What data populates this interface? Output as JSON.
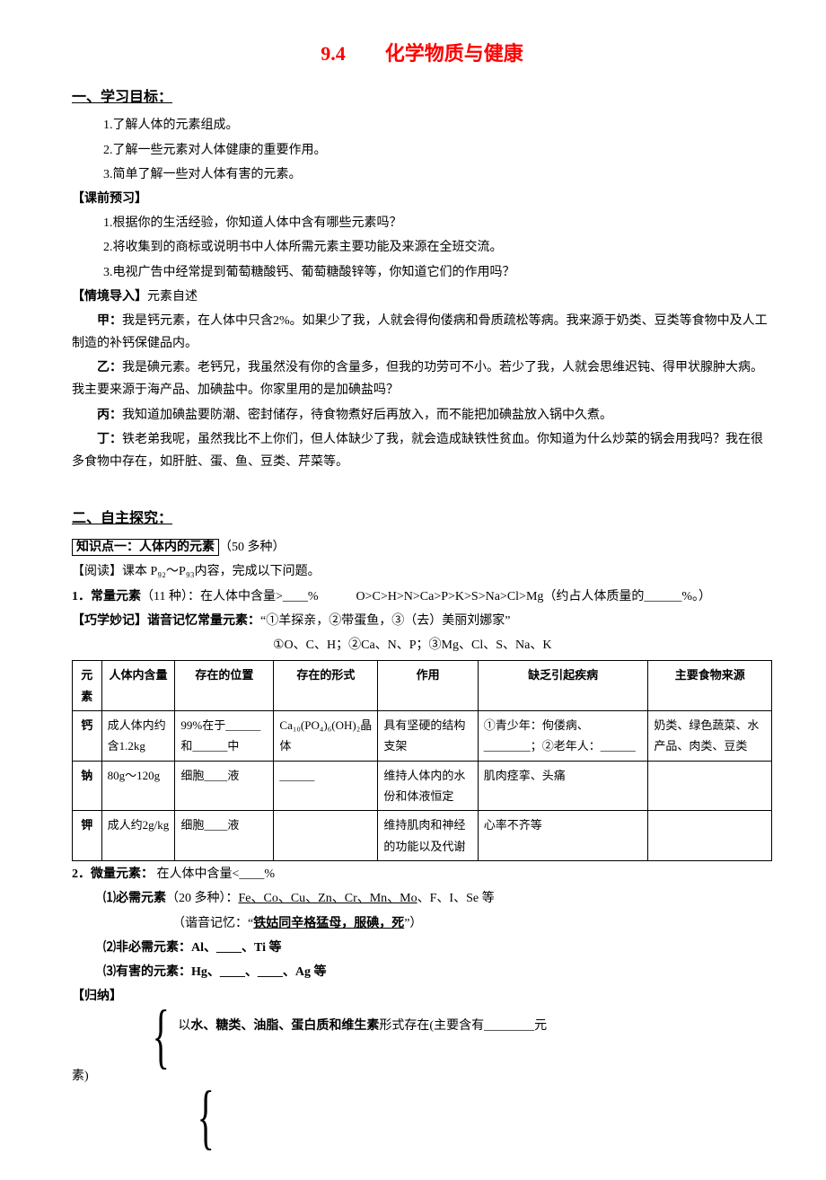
{
  "title": "9.4　　化学物质与健康",
  "section1": {
    "header": "一、学习目标：",
    "items": [
      "1.了解人体的元素组成。",
      "2.了解一些元素对人体健康的重要作用。",
      "3.简单了解一些对人体有害的元素。"
    ]
  },
  "preview": {
    "header": "【课前预习】",
    "items": [
      "1.根据你的生活经验，你知道人体中含有哪些元素吗？",
      "2.将收集到的商标或说明书中人体所需元素主要功能及来源在全班交流。",
      "3.电视广告中经常提到葡萄糖酸钙、葡萄糖酸锌等，你知道它们的作用吗？"
    ]
  },
  "intro": {
    "header": "【情境导入】",
    "subtitle": "元素自述",
    "jia_label": "甲：",
    "jia": "我是钙元素，在人体中只含2%。如果少了我，人就会得佝偻病和骨质疏松等病。我来源于奶类、豆类等食物中及人工制造的补钙保健品内。",
    "yi_label": "乙：",
    "yi": "我是碘元素。老钙兄，我虽然没有你的含量多，但我的功劳可不小。若少了我，人就会思维迟钝、得甲状腺肿大病。我主要来源于海产品、加碘盐中。你家里用的是加碘盐吗？",
    "bing_label": "丙：",
    "bing": "我知道加碘盐要防潮、密封储存，待食物煮好后再放入，而不能把加碘盐放入锅中久煮。",
    "ding_label": "丁：",
    "ding": "铁老弟我呢，虽然我比不上你们，但人体缺少了我，就会造成缺铁性贫血。你知道为什么炒菜的锅会用我吗？我在很多食物中存在，如肝脏、蛋、鱼、豆类、芹菜等。"
  },
  "section2": {
    "header": "二、自主探究：",
    "knowledge1": {
      "title": "知识点一：人体内的元素",
      "note": "（50 多种）"
    },
    "read": "【阅读】课本 P₉₂～P₉₃内容，完成以下问题。",
    "changLiang": {
      "label": "1．常量元素",
      "paren": "（11 种）：在人体中含量>____%　　　O>C>H>N>Ca>P>K>S>Na>Cl>Mg（约占人体质量的______%。）"
    },
    "mnemonic": {
      "head": "【巧学妙记】谐音记忆常量元素：",
      "quote": "“①羊探亲，②带蛋鱼，③（去）美丽刘娜家”",
      "line2": "①O、C、H；②Ca、N、P；③Mg、Cl、S、Na、K"
    },
    "table": {
      "headers": [
        "元素",
        "人体内含量",
        "存在的位置",
        "存在的形式",
        "作用",
        "缺乏引起疾病",
        "主要食物来源"
      ],
      "rows": [
        {
          "el": "钙",
          "amount": "成人体内约含1.2kg",
          "loc": "99%在于______和______中",
          "form": "Ca₁₀(PO₄)₆(OH)₂晶体",
          "role": "具有坚硬的结构支架",
          "deficiency": "①青少年：佝偻病、________；②老年人：______",
          "source": "奶类、绿色蔬菜、水产品、肉类、豆类"
        },
        {
          "el": "钠",
          "amount": "80g～120g",
          "loc": "细胞____液",
          "form": "______",
          "role": "维持人体内的水份和体液恒定",
          "deficiency": "肌肉痉挛、头痛",
          "source": ""
        },
        {
          "el": "钾",
          "amount": "成人约2g/kg",
          "loc": "细胞____液",
          "form": "",
          "role": "维持肌肉和神经的功能以及代谢",
          "deficiency": "心率不齐等",
          "source": ""
        }
      ]
    },
    "weiliang": {
      "label": "2．微量元素：",
      "text": " 在人体中含量<____%",
      "item1_label": "⑴必需元素",
      "item1_text": "（20 多种）：",
      "item1_list": "Fe、Co、Cu、Zn、Cr、Mn、Mo",
      "item1_rest": "、F、I、Se 等",
      "item1_mnemonic": "（谐音记忆：“",
      "item1_mnemonic_u": "铁姑同辛格猛母，服碘，死",
      "item1_mnemonic_end": "”）",
      "item2": "⑵非必需元素：Al、____、Ti 等",
      "item3": "⑶有害的元素：Hg、____、____、Ag 等"
    },
    "guina": "【归纳】",
    "summary1a": "以",
    "summary1b": "水、糖类、油脂、蛋白质和维生素",
    "summary1c": "形式存在(主要含有________元",
    "summary1d": "素)"
  }
}
